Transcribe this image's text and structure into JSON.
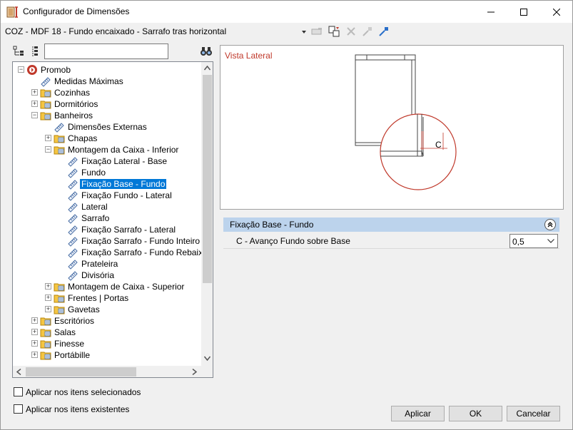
{
  "window": {
    "title": "Configurador de Dimensões"
  },
  "toolbar": {
    "combo_value": "COZ - MDF 18 - Fundo encaixado - Sarrafo tras horizontal"
  },
  "tree_search": {
    "value": "",
    "placeholder": ""
  },
  "tree": [
    {
      "label": "Promob",
      "level": 0,
      "expander": "minus",
      "icon": "promob-logo-icon"
    },
    {
      "label": "Medidas Máximas",
      "level": 1,
      "expander": "",
      "icon": "ruler-icon"
    },
    {
      "label": "Cozinhas",
      "level": 1,
      "expander": "plus",
      "icon": "folder-icon"
    },
    {
      "label": "Dormitórios",
      "level": 1,
      "expander": "plus",
      "icon": "folder-icon"
    },
    {
      "label": "Banheiros",
      "level": 1,
      "expander": "minus",
      "icon": "folder-icon"
    },
    {
      "label": "Dimensões Externas",
      "level": 2,
      "expander": "",
      "icon": "ruler-icon"
    },
    {
      "label": "Chapas",
      "level": 2,
      "expander": "plus",
      "icon": "folder-icon"
    },
    {
      "label": "Montagem da Caixa - Inferior",
      "level": 2,
      "expander": "minus",
      "icon": "folder-icon"
    },
    {
      "label": "Fixação Lateral - Base",
      "level": 3,
      "expander": "",
      "icon": "ruler-icon"
    },
    {
      "label": "Fundo",
      "level": 3,
      "expander": "",
      "icon": "ruler-icon"
    },
    {
      "label": "Fixação Base - Fundo",
      "level": 3,
      "expander": "",
      "icon": "ruler-icon",
      "selected": true
    },
    {
      "label": "Fixação Fundo - Lateral",
      "level": 3,
      "expander": "",
      "icon": "ruler-icon"
    },
    {
      "label": "Lateral",
      "level": 3,
      "expander": "",
      "icon": "ruler-icon"
    },
    {
      "label": "Sarrafo",
      "level": 3,
      "expander": "",
      "icon": "ruler-icon"
    },
    {
      "label": "Fixação Sarrafo - Lateral",
      "level": 3,
      "expander": "",
      "icon": "ruler-icon"
    },
    {
      "label": "Fixação Sarrafo - Fundo Inteiro",
      "level": 3,
      "expander": "",
      "icon": "ruler-icon"
    },
    {
      "label": "Fixação Sarrafo - Fundo Rebaixado",
      "level": 3,
      "expander": "",
      "icon": "ruler-icon"
    },
    {
      "label": "Prateleira",
      "level": 3,
      "expander": "",
      "icon": "ruler-icon"
    },
    {
      "label": "Divisória",
      "level": 3,
      "expander": "",
      "icon": "ruler-icon"
    },
    {
      "label": "Montagem de Caixa - Superior",
      "level": 2,
      "expander": "plus",
      "icon": "folder-icon"
    },
    {
      "label": "Frentes | Portas",
      "level": 2,
      "expander": "plus",
      "icon": "folder-icon"
    },
    {
      "label": "Gavetas",
      "level": 2,
      "expander": "plus",
      "icon": "folder-icon"
    },
    {
      "label": "Escritórios",
      "level": 1,
      "expander": "plus",
      "icon": "folder-icon"
    },
    {
      "label": "Salas",
      "level": 1,
      "expander": "plus",
      "icon": "folder-icon"
    },
    {
      "label": "Finesse",
      "level": 1,
      "expander": "plus",
      "icon": "folder-icon"
    },
    {
      "label": "Portábille",
      "level": 1,
      "expander": "plus",
      "icon": "folder-icon"
    }
  ],
  "preview": {
    "title": "Vista Lateral",
    "dimension_label": "C"
  },
  "properties": {
    "group_title": "Fixação Base - Fundo",
    "rows": [
      {
        "name": "C - Avanço Fundo sobre Base",
        "value": "0,5"
      }
    ]
  },
  "options": {
    "apply_selected": "Aplicar nos itens selecionados",
    "apply_existing": "Aplicar nos itens existentes"
  },
  "buttons": {
    "apply": "Aplicar",
    "ok": "OK",
    "cancel": "Cancelar"
  },
  "colors": {
    "selection": "#0078d7",
    "preview_title": "#c0392b",
    "group_header": "#bcd3ec"
  }
}
